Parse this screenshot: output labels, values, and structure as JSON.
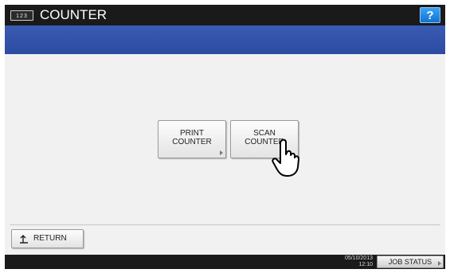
{
  "window": {
    "app_icon_text": "123",
    "title": "COUNTER",
    "help_label": "?"
  },
  "main": {
    "buttons": [
      {
        "id": "print_counter",
        "label": "PRINT\nCOUNTER"
      },
      {
        "id": "scan_counter",
        "label": "SCAN\nCOUNTER"
      }
    ]
  },
  "footer": {
    "return_label": "RETURN"
  },
  "status_bar": {
    "date": "05/10/2013",
    "time": "12:10",
    "job_status_label": "JOB STATUS"
  },
  "icons": {
    "app": "counter-icon",
    "help": "help-icon",
    "return": "return-arrow-icon",
    "cursor": "hand-pointer-icon"
  },
  "colors": {
    "title_bar": "#1a1a1a",
    "banner": "#2c4ca2",
    "help_button": "#1e88e5",
    "content_bg": "#f1f1f1"
  }
}
